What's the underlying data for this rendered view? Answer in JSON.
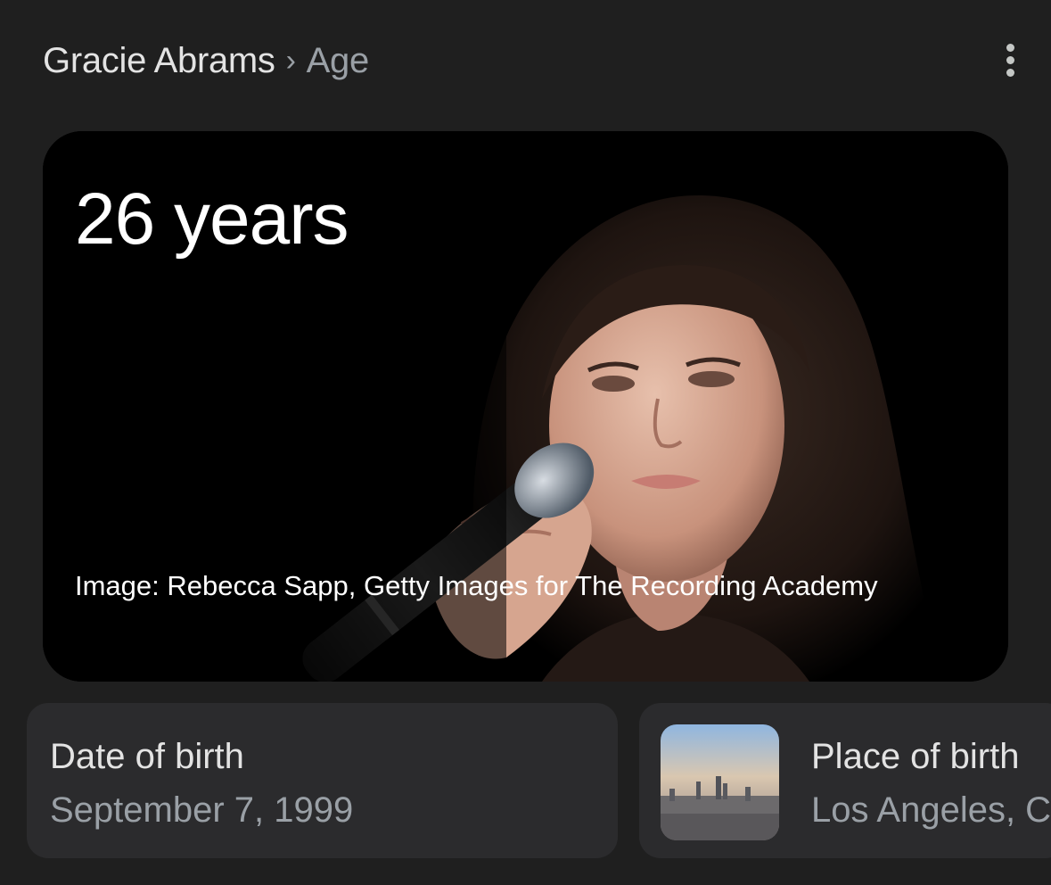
{
  "header": {
    "breadcrumb_main": "Gracie Abrams",
    "breadcrumb_separator": "›",
    "breadcrumb_current": "Age",
    "more_icon": "more-vert-icon"
  },
  "hero": {
    "age": "26 years",
    "credit": "Image: Rebecca Sapp, Getty Images for The Recording Academy"
  },
  "facts": [
    {
      "label": "Date of birth",
      "value": "September 7, 1999"
    },
    {
      "label": "Place of birth",
      "value": "Los Angeles, C",
      "thumbnail": "city-skyline-thumbnail"
    }
  ],
  "colors": {
    "background": "#1f1f1f",
    "card": "#2b2b2d",
    "text_primary": "#e3e3e3",
    "text_secondary": "#9aa0a6"
  }
}
